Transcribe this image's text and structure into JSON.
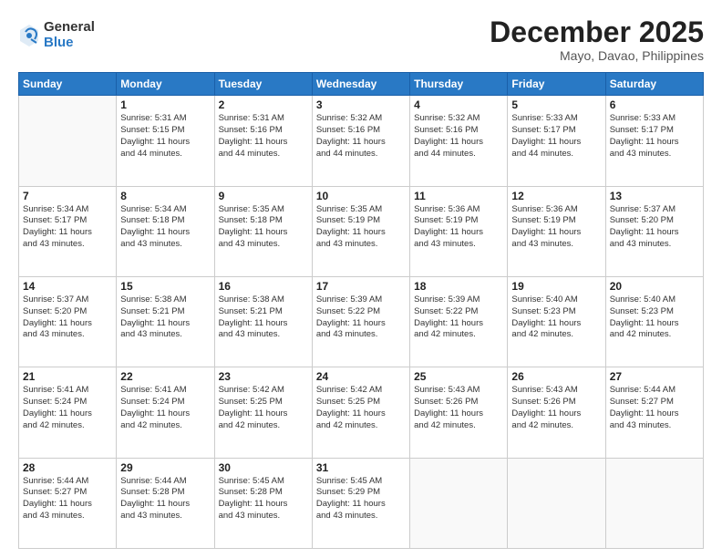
{
  "logo": {
    "general": "General",
    "blue": "Blue"
  },
  "header": {
    "month": "December 2025",
    "location": "Mayo, Davao, Philippines"
  },
  "weekdays": [
    "Sunday",
    "Monday",
    "Tuesday",
    "Wednesday",
    "Thursday",
    "Friday",
    "Saturday"
  ],
  "weeks": [
    [
      {
        "day": "",
        "info": ""
      },
      {
        "day": "1",
        "info": "Sunrise: 5:31 AM\nSunset: 5:15 PM\nDaylight: 11 hours\nand 44 minutes."
      },
      {
        "day": "2",
        "info": "Sunrise: 5:31 AM\nSunset: 5:16 PM\nDaylight: 11 hours\nand 44 minutes."
      },
      {
        "day": "3",
        "info": "Sunrise: 5:32 AM\nSunset: 5:16 PM\nDaylight: 11 hours\nand 44 minutes."
      },
      {
        "day": "4",
        "info": "Sunrise: 5:32 AM\nSunset: 5:16 PM\nDaylight: 11 hours\nand 44 minutes."
      },
      {
        "day": "5",
        "info": "Sunrise: 5:33 AM\nSunset: 5:17 PM\nDaylight: 11 hours\nand 44 minutes."
      },
      {
        "day": "6",
        "info": "Sunrise: 5:33 AM\nSunset: 5:17 PM\nDaylight: 11 hours\nand 43 minutes."
      }
    ],
    [
      {
        "day": "7",
        "info": "Sunrise: 5:34 AM\nSunset: 5:17 PM\nDaylight: 11 hours\nand 43 minutes."
      },
      {
        "day": "8",
        "info": "Sunrise: 5:34 AM\nSunset: 5:18 PM\nDaylight: 11 hours\nand 43 minutes."
      },
      {
        "day": "9",
        "info": "Sunrise: 5:35 AM\nSunset: 5:18 PM\nDaylight: 11 hours\nand 43 minutes."
      },
      {
        "day": "10",
        "info": "Sunrise: 5:35 AM\nSunset: 5:19 PM\nDaylight: 11 hours\nand 43 minutes."
      },
      {
        "day": "11",
        "info": "Sunrise: 5:36 AM\nSunset: 5:19 PM\nDaylight: 11 hours\nand 43 minutes."
      },
      {
        "day": "12",
        "info": "Sunrise: 5:36 AM\nSunset: 5:19 PM\nDaylight: 11 hours\nand 43 minutes."
      },
      {
        "day": "13",
        "info": "Sunrise: 5:37 AM\nSunset: 5:20 PM\nDaylight: 11 hours\nand 43 minutes."
      }
    ],
    [
      {
        "day": "14",
        "info": "Sunrise: 5:37 AM\nSunset: 5:20 PM\nDaylight: 11 hours\nand 43 minutes."
      },
      {
        "day": "15",
        "info": "Sunrise: 5:38 AM\nSunset: 5:21 PM\nDaylight: 11 hours\nand 43 minutes."
      },
      {
        "day": "16",
        "info": "Sunrise: 5:38 AM\nSunset: 5:21 PM\nDaylight: 11 hours\nand 43 minutes."
      },
      {
        "day": "17",
        "info": "Sunrise: 5:39 AM\nSunset: 5:22 PM\nDaylight: 11 hours\nand 43 minutes."
      },
      {
        "day": "18",
        "info": "Sunrise: 5:39 AM\nSunset: 5:22 PM\nDaylight: 11 hours\nand 42 minutes."
      },
      {
        "day": "19",
        "info": "Sunrise: 5:40 AM\nSunset: 5:23 PM\nDaylight: 11 hours\nand 42 minutes."
      },
      {
        "day": "20",
        "info": "Sunrise: 5:40 AM\nSunset: 5:23 PM\nDaylight: 11 hours\nand 42 minutes."
      }
    ],
    [
      {
        "day": "21",
        "info": "Sunrise: 5:41 AM\nSunset: 5:24 PM\nDaylight: 11 hours\nand 42 minutes."
      },
      {
        "day": "22",
        "info": "Sunrise: 5:41 AM\nSunset: 5:24 PM\nDaylight: 11 hours\nand 42 minutes."
      },
      {
        "day": "23",
        "info": "Sunrise: 5:42 AM\nSunset: 5:25 PM\nDaylight: 11 hours\nand 42 minutes."
      },
      {
        "day": "24",
        "info": "Sunrise: 5:42 AM\nSunset: 5:25 PM\nDaylight: 11 hours\nand 42 minutes."
      },
      {
        "day": "25",
        "info": "Sunrise: 5:43 AM\nSunset: 5:26 PM\nDaylight: 11 hours\nand 42 minutes."
      },
      {
        "day": "26",
        "info": "Sunrise: 5:43 AM\nSunset: 5:26 PM\nDaylight: 11 hours\nand 42 minutes."
      },
      {
        "day": "27",
        "info": "Sunrise: 5:44 AM\nSunset: 5:27 PM\nDaylight: 11 hours\nand 43 minutes."
      }
    ],
    [
      {
        "day": "28",
        "info": "Sunrise: 5:44 AM\nSunset: 5:27 PM\nDaylight: 11 hours\nand 43 minutes."
      },
      {
        "day": "29",
        "info": "Sunrise: 5:44 AM\nSunset: 5:28 PM\nDaylight: 11 hours\nand 43 minutes."
      },
      {
        "day": "30",
        "info": "Sunrise: 5:45 AM\nSunset: 5:28 PM\nDaylight: 11 hours\nand 43 minutes."
      },
      {
        "day": "31",
        "info": "Sunrise: 5:45 AM\nSunset: 5:29 PM\nDaylight: 11 hours\nand 43 minutes."
      },
      {
        "day": "",
        "info": ""
      },
      {
        "day": "",
        "info": ""
      },
      {
        "day": "",
        "info": ""
      }
    ]
  ]
}
